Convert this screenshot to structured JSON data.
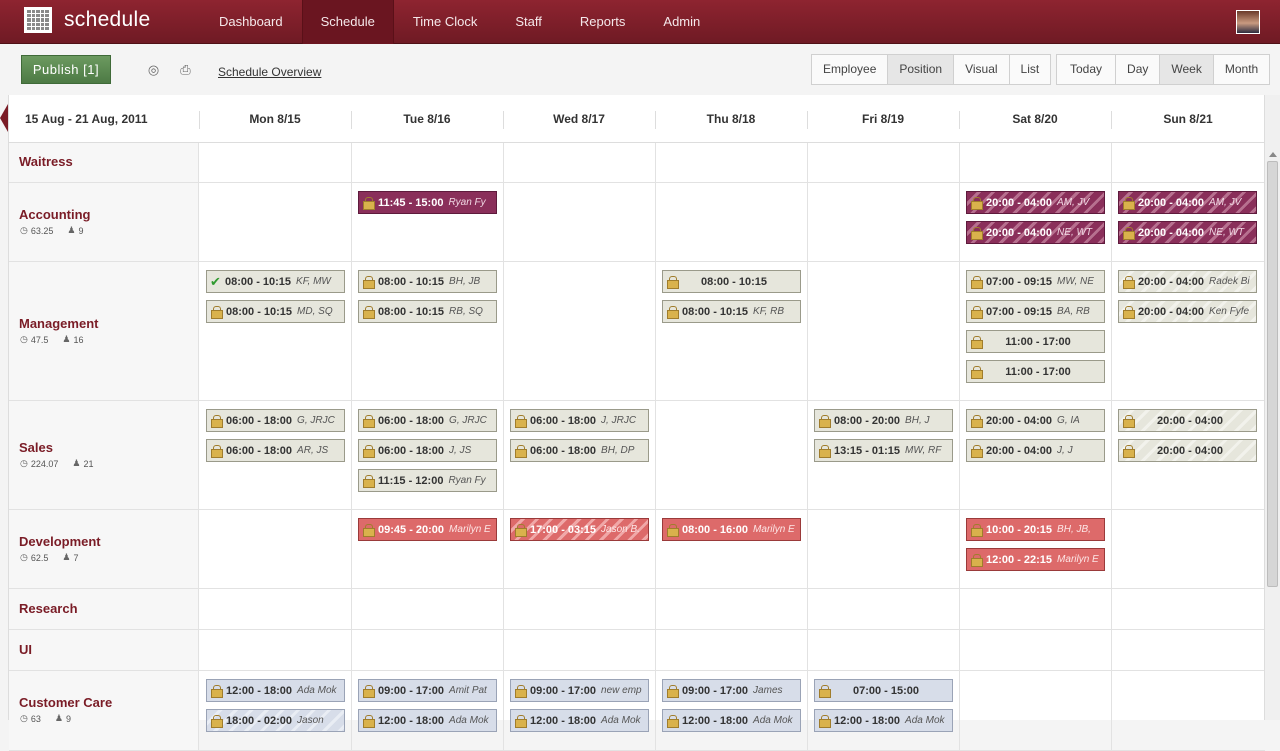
{
  "app": {
    "title": "schedule"
  },
  "nav": [
    {
      "label": "Dashboard",
      "active": false
    },
    {
      "label": "Schedule",
      "active": true
    },
    {
      "label": "Time Clock",
      "active": false
    },
    {
      "label": "Staff",
      "active": false
    },
    {
      "label": "Reports",
      "active": false
    },
    {
      "label": "Admin",
      "active": false
    }
  ],
  "toolbar": {
    "publish_label": "Publish [1]",
    "overview_link": "Schedule Overview",
    "view_modes": [
      "Employee",
      "Position",
      "Visual",
      "List"
    ],
    "active_view_mode": "Position",
    "ranges": [
      "Today",
      "Day",
      "Week",
      "Month"
    ],
    "active_range": "Week"
  },
  "header": {
    "range": "15 Aug - 21 Aug, 2011",
    "days": [
      "Mon 8/15",
      "Tue 8/16",
      "Wed 8/17",
      "Thu 8/18",
      "Fri 8/19",
      "Sat 8/20",
      "Sun 8/21"
    ]
  },
  "positions": [
    {
      "name": "Waitress",
      "hours": "",
      "staff": "",
      "shifts": []
    },
    {
      "name": "Accounting",
      "hours": "63.25",
      "staff": "9",
      "shifts": [
        {
          "day": 1,
          "slot": 0,
          "time": "11:45 - 15:00",
          "who": "Ryan Fy",
          "color": "purple"
        },
        {
          "day": 5,
          "slot": 0,
          "time": "20:00 - 04:00",
          "who": "AM, JV",
          "color": "purple",
          "striped": true
        },
        {
          "day": 5,
          "slot": 1,
          "time": "20:00 - 04:00",
          "who": "NE, WT",
          "color": "purple",
          "striped": true
        },
        {
          "day": 6,
          "slot": 0,
          "time": "20:00 - 04:00",
          "who": "AM, JV",
          "color": "purple",
          "striped": true
        },
        {
          "day": 6,
          "slot": 1,
          "time": "20:00 - 04:00",
          "who": "NE, WT",
          "color": "purple",
          "striped": true
        }
      ]
    },
    {
      "name": "Management",
      "hours": "47.5",
      "staff": "16",
      "shifts": [
        {
          "day": 0,
          "slot": 0,
          "time": "08:00 - 10:15",
          "who": "KF, MW",
          "color": "gray",
          "check": true
        },
        {
          "day": 0,
          "slot": 1,
          "time": "08:00 - 10:15",
          "who": "MD, SQ",
          "color": "gray"
        },
        {
          "day": 1,
          "slot": 0,
          "time": "08:00 - 10:15",
          "who": "BH, JB",
          "color": "gray"
        },
        {
          "day": 1,
          "slot": 1,
          "time": "08:00 - 10:15",
          "who": "RB, SQ",
          "color": "gray"
        },
        {
          "day": 3,
          "slot": 0,
          "time": "08:00 - 10:15",
          "who": "",
          "color": "gray"
        },
        {
          "day": 3,
          "slot": 1,
          "time": "08:00 - 10:15",
          "who": "KF, RB",
          "color": "gray"
        },
        {
          "day": 5,
          "slot": 0,
          "time": "07:00 - 09:15",
          "who": "MW, NE",
          "color": "gray"
        },
        {
          "day": 5,
          "slot": 1,
          "time": "07:00 - 09:15",
          "who": "BA, RB",
          "color": "gray"
        },
        {
          "day": 5,
          "slot": 2,
          "time": "11:00 - 17:00",
          "who": "",
          "color": "gray"
        },
        {
          "day": 5,
          "slot": 3,
          "time": "11:00 - 17:00",
          "who": "",
          "color": "gray"
        },
        {
          "day": 6,
          "slot": 0,
          "time": "20:00 - 04:00",
          "who": "Radek Bi",
          "color": "gray",
          "striped": true
        },
        {
          "day": 6,
          "slot": 1,
          "time": "20:00 - 04:00",
          "who": "Ken Fyfe",
          "color": "gray",
          "striped": true
        }
      ]
    },
    {
      "name": "Sales",
      "hours": "224.07",
      "staff": "21",
      "shifts": [
        {
          "day": 0,
          "slot": 0,
          "time": "06:00 - 18:00",
          "who": "G, JRJC",
          "color": "gray"
        },
        {
          "day": 0,
          "slot": 1,
          "time": "06:00 - 18:00",
          "who": "AR, JS",
          "color": "gray"
        },
        {
          "day": 1,
          "slot": 0,
          "time": "06:00 - 18:00",
          "who": "G, JRJC",
          "color": "gray"
        },
        {
          "day": 1,
          "slot": 1,
          "time": "06:00 - 18:00",
          "who": "J, JS",
          "color": "gray"
        },
        {
          "day": 1,
          "slot": 2,
          "time": "11:15 - 12:00",
          "who": "Ryan Fy",
          "color": "gray"
        },
        {
          "day": 2,
          "slot": 0,
          "time": "06:00 - 18:00",
          "who": "J, JRJC",
          "color": "gray"
        },
        {
          "day": 2,
          "slot": 1,
          "time": "06:00 - 18:00",
          "who": "BH, DP",
          "color": "gray"
        },
        {
          "day": 4,
          "slot": 0,
          "time": "08:00 - 20:00",
          "who": "BH, J",
          "color": "gray"
        },
        {
          "day": 4,
          "slot": 1,
          "time": "13:15 - 01:15",
          "who": "MW, RF",
          "color": "gray"
        },
        {
          "day": 5,
          "slot": 0,
          "time": "20:00 - 04:00",
          "who": "G, IA",
          "color": "gray"
        },
        {
          "day": 5,
          "slot": 1,
          "time": "20:00 - 04:00",
          "who": "J, J",
          "color": "gray"
        },
        {
          "day": 6,
          "slot": 0,
          "time": "20:00 - 04:00",
          "who": "",
          "color": "gray",
          "striped": true
        },
        {
          "day": 6,
          "slot": 1,
          "time": "20:00 - 04:00",
          "who": "",
          "color": "gray",
          "striped": true
        }
      ]
    },
    {
      "name": "Development",
      "hours": "62.5",
      "staff": "7",
      "shifts": [
        {
          "day": 1,
          "slot": 0,
          "time": "09:45 - 20:00",
          "who": "Marilyn E",
          "color": "red"
        },
        {
          "day": 2,
          "slot": 0,
          "time": "17:00 - 03:15",
          "who": "Jason B.",
          "color": "red",
          "striped": true
        },
        {
          "day": 3,
          "slot": 0,
          "time": "08:00 - 16:00",
          "who": "Marilyn E",
          "color": "red"
        },
        {
          "day": 5,
          "slot": 0,
          "time": "10:00 - 20:15",
          "who": "BH, JB,",
          "color": "red"
        },
        {
          "day": 5,
          "slot": 1,
          "time": "12:00 - 22:15",
          "who": "Marilyn E",
          "color": "red"
        }
      ]
    },
    {
      "name": "Research",
      "hours": "",
      "staff": "",
      "shifts": []
    },
    {
      "name": "UI",
      "hours": "",
      "staff": "",
      "shifts": []
    },
    {
      "name": "Customer Care",
      "hours": "63",
      "staff": "9",
      "shifts": [
        {
          "day": 0,
          "slot": 0,
          "time": "12:00 - 18:00",
          "who": "Ada Mok",
          "color": "blue"
        },
        {
          "day": 0,
          "slot": 1,
          "time": "18:00 - 02:00",
          "who": "Jason",
          "color": "blue",
          "striped": true
        },
        {
          "day": 1,
          "slot": 0,
          "time": "09:00 - 17:00",
          "who": "Amit Pat",
          "color": "blue"
        },
        {
          "day": 1,
          "slot": 1,
          "time": "12:00 - 18:00",
          "who": "Ada Mok",
          "color": "blue"
        },
        {
          "day": 2,
          "slot": 0,
          "time": "09:00 - 17:00",
          "who": "new emp",
          "color": "blue"
        },
        {
          "day": 2,
          "slot": 1,
          "time": "12:00 - 18:00",
          "who": "Ada Mok",
          "color": "blue"
        },
        {
          "day": 3,
          "slot": 0,
          "time": "09:00 - 17:00",
          "who": "James",
          "color": "blue"
        },
        {
          "day": 3,
          "slot": 1,
          "time": "12:00 - 18:00",
          "who": "Ada Mok",
          "color": "blue"
        },
        {
          "day": 4,
          "slot": 0,
          "time": "07:00 - 15:00",
          "who": "",
          "color": "blue"
        },
        {
          "day": 4,
          "slot": 1,
          "time": "12:00 - 18:00",
          "who": "Ada Mok",
          "color": "blue"
        }
      ]
    }
  ],
  "colors": {
    "brand": "#7a1c26",
    "publish": "#5a8a50",
    "shift_gray": "#e6e6dc",
    "shift_purple": "#8a2f5a",
    "shift_red": "#dd6a6a",
    "shift_blue": "#d7dde9"
  }
}
